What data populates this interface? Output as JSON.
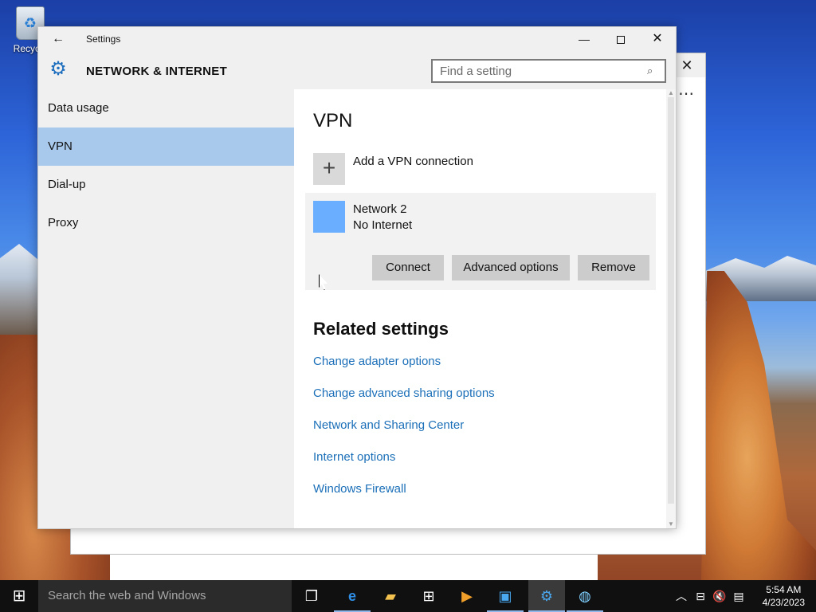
{
  "desktop": {
    "recycle_bin_label": "Recycle"
  },
  "settings_window": {
    "title": "Settings",
    "section_title": "NETWORK & INTERNET",
    "search": {
      "placeholder": "Find a setting",
      "value": ""
    },
    "sidebar": {
      "items": [
        {
          "label": "Data usage",
          "active": false
        },
        {
          "label": "VPN",
          "active": true
        },
        {
          "label": "Dial-up",
          "active": false
        },
        {
          "label": "Proxy",
          "active": false
        }
      ]
    },
    "main": {
      "heading": "VPN",
      "add_vpn_label": "Add a VPN connection",
      "connection": {
        "name": "Network 2",
        "status": "No Internet",
        "buttons": {
          "connect": "Connect",
          "advanced": "Advanced options",
          "remove": "Remove"
        }
      },
      "related_heading": "Related settings",
      "related_links": [
        "Change adapter options",
        "Change advanced sharing options",
        "Network and Sharing Center",
        "Internet options",
        "Windows Firewall"
      ]
    }
  },
  "taskbar": {
    "search_placeholder": "Search the web and Windows",
    "clock": {
      "time": "5:54 AM",
      "date": "4/23/2023"
    }
  },
  "colors": {
    "accent": "#1b6fb8",
    "selected_nav": "#a8c9ec",
    "vpn_icon": "#6aafff"
  }
}
